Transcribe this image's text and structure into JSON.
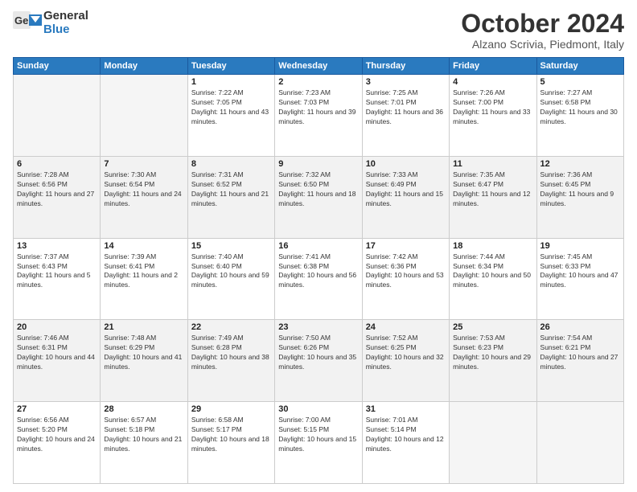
{
  "header": {
    "logo_general": "General",
    "logo_blue": "Blue",
    "month_title": "October 2024",
    "location": "Alzano Scrivia, Piedmont, Italy"
  },
  "days_of_week": [
    "Sunday",
    "Monday",
    "Tuesday",
    "Wednesday",
    "Thursday",
    "Friday",
    "Saturday"
  ],
  "weeks": [
    [
      {
        "num": "",
        "info": ""
      },
      {
        "num": "",
        "info": ""
      },
      {
        "num": "1",
        "info": "Sunrise: 7:22 AM\nSunset: 7:05 PM\nDaylight: 11 hours and 43 minutes."
      },
      {
        "num": "2",
        "info": "Sunrise: 7:23 AM\nSunset: 7:03 PM\nDaylight: 11 hours and 39 minutes."
      },
      {
        "num": "3",
        "info": "Sunrise: 7:25 AM\nSunset: 7:01 PM\nDaylight: 11 hours and 36 minutes."
      },
      {
        "num": "4",
        "info": "Sunrise: 7:26 AM\nSunset: 7:00 PM\nDaylight: 11 hours and 33 minutes."
      },
      {
        "num": "5",
        "info": "Sunrise: 7:27 AM\nSunset: 6:58 PM\nDaylight: 11 hours and 30 minutes."
      }
    ],
    [
      {
        "num": "6",
        "info": "Sunrise: 7:28 AM\nSunset: 6:56 PM\nDaylight: 11 hours and 27 minutes."
      },
      {
        "num": "7",
        "info": "Sunrise: 7:30 AM\nSunset: 6:54 PM\nDaylight: 11 hours and 24 minutes."
      },
      {
        "num": "8",
        "info": "Sunrise: 7:31 AM\nSunset: 6:52 PM\nDaylight: 11 hours and 21 minutes."
      },
      {
        "num": "9",
        "info": "Sunrise: 7:32 AM\nSunset: 6:50 PM\nDaylight: 11 hours and 18 minutes."
      },
      {
        "num": "10",
        "info": "Sunrise: 7:33 AM\nSunset: 6:49 PM\nDaylight: 11 hours and 15 minutes."
      },
      {
        "num": "11",
        "info": "Sunrise: 7:35 AM\nSunset: 6:47 PM\nDaylight: 11 hours and 12 minutes."
      },
      {
        "num": "12",
        "info": "Sunrise: 7:36 AM\nSunset: 6:45 PM\nDaylight: 11 hours and 9 minutes."
      }
    ],
    [
      {
        "num": "13",
        "info": "Sunrise: 7:37 AM\nSunset: 6:43 PM\nDaylight: 11 hours and 5 minutes."
      },
      {
        "num": "14",
        "info": "Sunrise: 7:39 AM\nSunset: 6:41 PM\nDaylight: 11 hours and 2 minutes."
      },
      {
        "num": "15",
        "info": "Sunrise: 7:40 AM\nSunset: 6:40 PM\nDaylight: 10 hours and 59 minutes."
      },
      {
        "num": "16",
        "info": "Sunrise: 7:41 AM\nSunset: 6:38 PM\nDaylight: 10 hours and 56 minutes."
      },
      {
        "num": "17",
        "info": "Sunrise: 7:42 AM\nSunset: 6:36 PM\nDaylight: 10 hours and 53 minutes."
      },
      {
        "num": "18",
        "info": "Sunrise: 7:44 AM\nSunset: 6:34 PM\nDaylight: 10 hours and 50 minutes."
      },
      {
        "num": "19",
        "info": "Sunrise: 7:45 AM\nSunset: 6:33 PM\nDaylight: 10 hours and 47 minutes."
      }
    ],
    [
      {
        "num": "20",
        "info": "Sunrise: 7:46 AM\nSunset: 6:31 PM\nDaylight: 10 hours and 44 minutes."
      },
      {
        "num": "21",
        "info": "Sunrise: 7:48 AM\nSunset: 6:29 PM\nDaylight: 10 hours and 41 minutes."
      },
      {
        "num": "22",
        "info": "Sunrise: 7:49 AM\nSunset: 6:28 PM\nDaylight: 10 hours and 38 minutes."
      },
      {
        "num": "23",
        "info": "Sunrise: 7:50 AM\nSunset: 6:26 PM\nDaylight: 10 hours and 35 minutes."
      },
      {
        "num": "24",
        "info": "Sunrise: 7:52 AM\nSunset: 6:25 PM\nDaylight: 10 hours and 32 minutes."
      },
      {
        "num": "25",
        "info": "Sunrise: 7:53 AM\nSunset: 6:23 PM\nDaylight: 10 hours and 29 minutes."
      },
      {
        "num": "26",
        "info": "Sunrise: 7:54 AM\nSunset: 6:21 PM\nDaylight: 10 hours and 27 minutes."
      }
    ],
    [
      {
        "num": "27",
        "info": "Sunrise: 6:56 AM\nSunset: 5:20 PM\nDaylight: 10 hours and 24 minutes."
      },
      {
        "num": "28",
        "info": "Sunrise: 6:57 AM\nSunset: 5:18 PM\nDaylight: 10 hours and 21 minutes."
      },
      {
        "num": "29",
        "info": "Sunrise: 6:58 AM\nSunset: 5:17 PM\nDaylight: 10 hours and 18 minutes."
      },
      {
        "num": "30",
        "info": "Sunrise: 7:00 AM\nSunset: 5:15 PM\nDaylight: 10 hours and 15 minutes."
      },
      {
        "num": "31",
        "info": "Sunrise: 7:01 AM\nSunset: 5:14 PM\nDaylight: 10 hours and 12 minutes."
      },
      {
        "num": "",
        "info": ""
      },
      {
        "num": "",
        "info": ""
      }
    ]
  ]
}
